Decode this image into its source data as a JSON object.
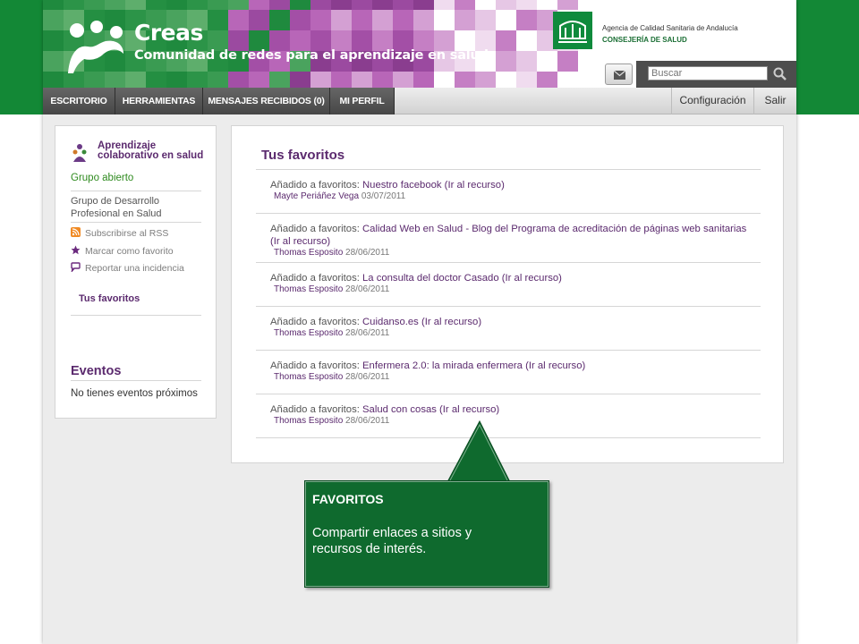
{
  "brand": {
    "title": "Creas",
    "subtitle": "Comunidad de redes para el aprendizaje en salud"
  },
  "agency": {
    "line1": "Agencia de Calidad Sanitaria de Andalucía",
    "line2": "CONSEJERÍA DE SALUD"
  },
  "search": {
    "placeholder": "Buscar"
  },
  "nav": {
    "tabs": [
      "ESCRITORIO",
      "HERRAMIENTAS",
      "MENSAJES RECIBIDOS (0)",
      "MI PERFIL"
    ],
    "right": [
      "Configuración",
      "Salir"
    ]
  },
  "sidebar": {
    "group_name": "Aprendizaje colaborativo en salud",
    "group_status": "Grupo abierto",
    "owner": "Grupo de Desarrollo Profesional en Salud",
    "actions": [
      "Subscribirse al RSS",
      "Marcar como favorito",
      "Reportar una incidencia"
    ],
    "current": "Tus favoritos",
    "events_title": "Eventos",
    "events_empty": "No tienes eventos próximos"
  },
  "main": {
    "title": "Tus favoritos",
    "prefix": "Añadido a favoritos:",
    "items": [
      {
        "link": "Nuestro facebook (Ir al recurso)",
        "author": "Mayte Periáñez Vega",
        "date": "03/07/2011"
      },
      {
        "link": "Calidad Web en Salud - Blog del Programa de acreditación de páginas web sanitarias (Ir al recurso)",
        "author": "Thomas Esposito",
        "date": "28/06/2011"
      },
      {
        "link": "La consulta del doctor Casado (Ir al recurso)",
        "author": "Thomas Esposito",
        "date": "28/06/2011"
      },
      {
        "link": "Cuidanso.es (Ir al recurso)",
        "author": "Thomas Esposito",
        "date": "28/06/2011"
      },
      {
        "link": "Enfermera 2.0: la mirada enfermera (Ir al recurso)",
        "author": "Thomas Esposito",
        "date": "28/06/2011"
      },
      {
        "link": "Salud con cosas (Ir al recurso)",
        "author": "Thomas Esposito",
        "date": "28/06/2011"
      }
    ]
  },
  "callout": {
    "title": "FAVORITOS",
    "text": "Compartir enlaces a sitios y recursos de interés."
  },
  "colors": {
    "brand_green": "#138836",
    "purple": "#5b2a6e",
    "callout_green": "#0f6a2e",
    "nav_dark": "#4d4d4d"
  }
}
